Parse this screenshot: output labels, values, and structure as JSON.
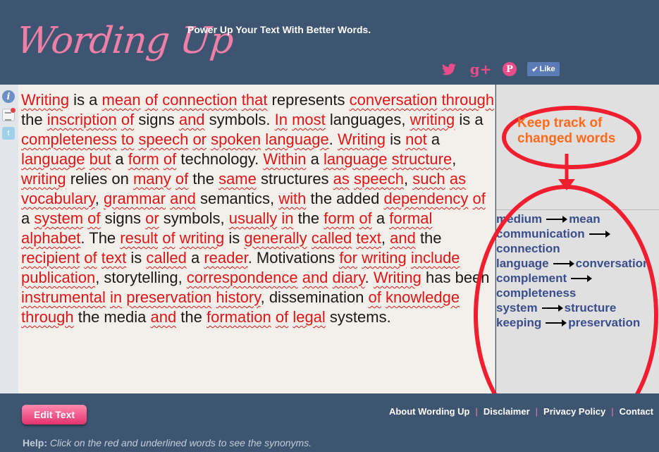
{
  "header": {
    "logo": "Wording Up",
    "tagline": "Power Up Your Text With Better Words.",
    "social": {
      "twitter": "twitter-icon",
      "googleplus_glyph": "g+",
      "pinterest_glyph": "P",
      "facebook_like": "Like"
    }
  },
  "text_words": [
    [
      "Writing",
      true
    ],
    [
      " is a ",
      false
    ],
    [
      "mean",
      true
    ],
    [
      " ",
      false
    ],
    [
      "of",
      true
    ],
    [
      " ",
      false
    ],
    [
      "connection",
      true
    ],
    [
      " ",
      false
    ],
    [
      "that",
      true
    ],
    [
      " represents ",
      false
    ],
    [
      "conversation",
      true
    ],
    [
      " ",
      false
    ],
    [
      "through",
      true
    ],
    [
      " the ",
      false
    ],
    [
      "inscription",
      true
    ],
    [
      " ",
      false
    ],
    [
      "of",
      true
    ],
    [
      " signs ",
      false
    ],
    [
      "and",
      true
    ],
    [
      " symbols. ",
      false
    ],
    [
      "In",
      true
    ],
    [
      " ",
      false
    ],
    [
      "most",
      true
    ],
    [
      " languages, ",
      false
    ],
    [
      "writing",
      true
    ],
    [
      " is a ",
      false
    ],
    [
      "completeness",
      true
    ],
    [
      " ",
      false
    ],
    [
      "to",
      true
    ],
    [
      " ",
      false
    ],
    [
      "speech",
      true
    ],
    [
      " ",
      false
    ],
    [
      "or",
      true
    ],
    [
      " ",
      false
    ],
    [
      "spoken",
      true
    ],
    [
      " ",
      false
    ],
    [
      "language",
      true
    ],
    [
      ". ",
      false
    ],
    [
      "Writing",
      true
    ],
    [
      " is ",
      false
    ],
    [
      "not",
      true
    ],
    [
      " a ",
      false
    ],
    [
      "language",
      true
    ],
    [
      " ",
      false
    ],
    [
      "but",
      true
    ],
    [
      " a ",
      false
    ],
    [
      "form",
      true
    ],
    [
      " ",
      false
    ],
    [
      "of",
      true
    ],
    [
      " technology. ",
      false
    ],
    [
      "Within",
      true
    ],
    [
      " a ",
      false
    ],
    [
      "language",
      true
    ],
    [
      " ",
      false
    ],
    [
      "structure",
      true
    ],
    [
      ", ",
      false
    ],
    [
      "writing",
      true
    ],
    [
      " relies on ",
      false
    ],
    [
      "many",
      true
    ],
    [
      " ",
      false
    ],
    [
      "of",
      true
    ],
    [
      " the ",
      false
    ],
    [
      "same",
      true
    ],
    [
      " structures ",
      false
    ],
    [
      "as",
      true
    ],
    [
      " ",
      false
    ],
    [
      "speech",
      true
    ],
    [
      ", ",
      false
    ],
    [
      "such",
      true
    ],
    [
      " ",
      false
    ],
    [
      "as",
      true
    ],
    [
      " ",
      false
    ],
    [
      "vocabulary",
      true
    ],
    [
      ", ",
      false
    ],
    [
      "grammar",
      true
    ],
    [
      " ",
      false
    ],
    [
      "and",
      true
    ],
    [
      " semantics, ",
      false
    ],
    [
      "with",
      true
    ],
    [
      " the added ",
      false
    ],
    [
      "dependency",
      true
    ],
    [
      " ",
      false
    ],
    [
      "of",
      true
    ],
    [
      " a ",
      false
    ],
    [
      "system",
      true
    ],
    [
      " ",
      false
    ],
    [
      "of",
      true
    ],
    [
      " signs ",
      false
    ],
    [
      "or",
      true
    ],
    [
      " symbols, ",
      false
    ],
    [
      "usually",
      true
    ],
    [
      " ",
      false
    ],
    [
      "in",
      true
    ],
    [
      " the ",
      false
    ],
    [
      "form",
      true
    ],
    [
      " ",
      false
    ],
    [
      "of",
      true
    ],
    [
      " a ",
      false
    ],
    [
      "formal",
      true
    ],
    [
      " ",
      false
    ],
    [
      "alphabet",
      true
    ],
    [
      ". The ",
      false
    ],
    [
      "result",
      true
    ],
    [
      " ",
      false
    ],
    [
      "of",
      true
    ],
    [
      " ",
      false
    ],
    [
      "writing",
      true
    ],
    [
      " is ",
      false
    ],
    [
      "generally",
      true
    ],
    [
      " ",
      false
    ],
    [
      "called",
      true
    ],
    [
      " ",
      false
    ],
    [
      "text",
      true
    ],
    [
      ", ",
      false
    ],
    [
      "and",
      true
    ],
    [
      " the ",
      false
    ],
    [
      "recipient",
      true
    ],
    [
      " ",
      false
    ],
    [
      "of",
      true
    ],
    [
      " ",
      false
    ],
    [
      "text",
      true
    ],
    [
      " is ",
      false
    ],
    [
      "called",
      true
    ],
    [
      " a ",
      false
    ],
    [
      "reader",
      true
    ],
    [
      ". Motivations ",
      false
    ],
    [
      "for",
      true
    ],
    [
      " ",
      false
    ],
    [
      "writing",
      true
    ],
    [
      " ",
      false
    ],
    [
      "include",
      true
    ],
    [
      " ",
      false
    ],
    [
      "publication",
      true
    ],
    [
      ", storytelling, ",
      false
    ],
    [
      "correspondence",
      true
    ],
    [
      " ",
      false
    ],
    [
      "and",
      true
    ],
    [
      " ",
      false
    ],
    [
      "diary",
      true
    ],
    [
      ". ",
      false
    ],
    [
      "Writing",
      true
    ],
    [
      " has been ",
      false
    ],
    [
      "instrumental",
      true
    ],
    [
      " ",
      false
    ],
    [
      "in",
      true
    ],
    [
      " ",
      false
    ],
    [
      "preservation",
      true
    ],
    [
      " ",
      false
    ],
    [
      "history",
      true
    ],
    [
      ", dissemination ",
      false
    ],
    [
      "of",
      true
    ],
    [
      " ",
      false
    ],
    [
      "knowledge",
      true
    ],
    [
      " ",
      false
    ],
    [
      "through",
      true
    ],
    [
      " the media ",
      false
    ],
    [
      "and",
      true
    ],
    [
      " the ",
      false
    ],
    [
      "formation",
      true
    ],
    [
      " ",
      false
    ],
    [
      "of",
      true
    ],
    [
      " ",
      false
    ],
    [
      "legal",
      true
    ],
    [
      " systems.",
      false
    ]
  ],
  "annotation": {
    "note": "Keep track of changed words"
  },
  "changes": [
    {
      "from": "medium",
      "to": "mean"
    },
    {
      "from": "communication",
      "to": ""
    },
    {
      "from": "connection",
      "to": null
    },
    {
      "from": "language",
      "to": "conversation"
    },
    {
      "from": "complement",
      "to": ""
    },
    {
      "from": "completeness",
      "to": null
    },
    {
      "from": "system",
      "to": "structure"
    },
    {
      "from": "keeping",
      "to": "preservation"
    }
  ],
  "footer": {
    "edit_button": "Edit Text",
    "links": [
      "About Wording Up",
      "Disclaimer",
      "Privacy Policy",
      "Contact"
    ],
    "help_label": "Help:",
    "help_text": "Click on the red and underlined words to see the synonyms."
  },
  "colors": {
    "background": "#3d5570",
    "accent_pink": "#f07fa8",
    "highlight_red": "#e01616",
    "annotation_red": "#f01e2e",
    "change_blue": "#3b4d8c"
  }
}
